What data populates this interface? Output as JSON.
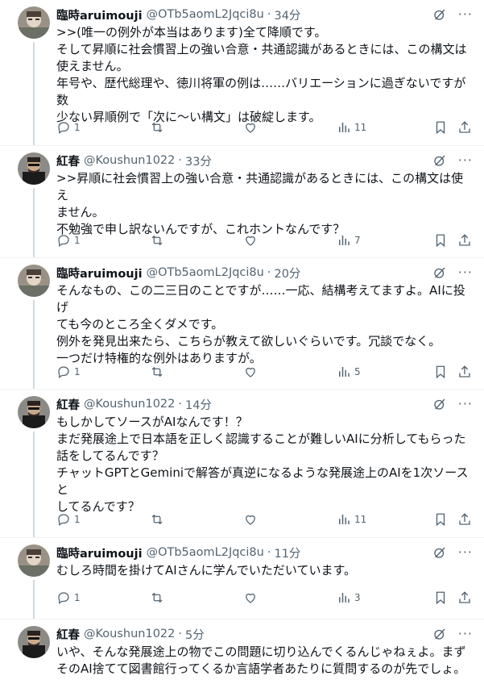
{
  "tweets": [
    {
      "name": "臨時aruimouji",
      "handle": "@OTb5aomL2Jqci8u",
      "sep": "·",
      "time": "34分",
      "lines": [
        ">>(唯一の例外が本当はあります)全て降順です。",
        "そして昇順に社会慣習上の強い合意・共通認識があるときには、この構文は",
        "使えません。",
        "年号や、歴代総理や、徳川将軍の例は……バリエーションに過ぎないですが数",
        "少ない昇順例で「次に〜い構文」は破綻します。"
      ],
      "replies": "1",
      "views": "11"
    },
    {
      "name": "紅春",
      "handle": "@Koushun1022",
      "sep": "·",
      "time": "33分",
      "lines": [
        ">>昇順に社会慣習上の強い合意・共通認識があるときには、この構文は使え",
        "ません。",
        "不勉強で申し訳ないんですが、これホントなんです？"
      ],
      "replies": "1",
      "views": "7"
    },
    {
      "name": "臨時aruimouji",
      "handle": "@OTb5aomL2Jqci8u",
      "sep": "·",
      "time": "20分",
      "lines": [
        "そんなもの、この二三日のことですが……一応、結構考えてますよ。AIに投げ",
        "ても今のところ全くダメです。",
        "例外を発見出来たら、こちらが教えて欲しいぐらいです。冗談でなく。",
        "一つだけ特権的な例外はありますが。"
      ],
      "replies": "1",
      "views": "5"
    },
    {
      "name": "紅春",
      "handle": "@Koushun1022",
      "sep": "·",
      "time": "14分",
      "lines": [
        "もしかしてソースがAIなんです！？",
        "まだ発展途上で日本語を正しく認識することが難しいAIに分析してもらった",
        "話をしてるんです？",
        "チャットGPTとGeminiで解答が真逆になるような発展途上のAIを1次ソースと",
        "してるんです？"
      ],
      "replies": "1",
      "views": "11"
    },
    {
      "name": "臨時aruimouji",
      "handle": "@OTb5aomL2Jqci8u",
      "sep": "·",
      "time": "11分",
      "lines": [
        "むしろ時間を掛けてAIさんに学んでいただいています。"
      ],
      "replies": "1",
      "views": "3"
    },
    {
      "name": "紅春",
      "handle": "@Koushun1022",
      "sep": "·",
      "time": "5分",
      "lines": [
        "いや、そんな発展途上の物でこの問題に切り込んでくるんじゃねぇよ。まず",
        "そのAI捨てて図書館行ってくるか言語学者あたりに質問するのが先でしょ。"
      ],
      "replies": "",
      "views": ""
    }
  ],
  "icons": {
    "reply": "reply-icon",
    "retweet": "retweet-icon",
    "like": "like-icon",
    "views": "views-icon",
    "bookmark": "bookmark-icon",
    "share": "share-icon",
    "grok": "grok-icon",
    "more": "more-icon"
  },
  "colors": {
    "text": "#0f1419",
    "secondary": "#536471",
    "divider": "#eff3f4",
    "thread_line": "#cfd9de"
  }
}
